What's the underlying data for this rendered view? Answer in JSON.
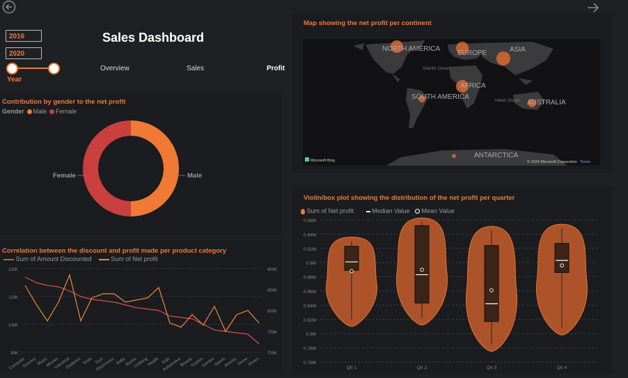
{
  "nav": {
    "back_icon": "back-arrow-icon",
    "forward_icon": "forward-arrow-icon"
  },
  "header": {
    "title": "Sales Dashboard"
  },
  "year_filter": {
    "start": "2016",
    "end": "2020",
    "label": "Year"
  },
  "tabs": [
    {
      "label": "Overview"
    },
    {
      "label": "Sales"
    },
    {
      "label": "Profit"
    }
  ],
  "donut": {
    "title": "Contribution by gender to the net profit",
    "legend_title": "Gender",
    "legend": [
      {
        "label": "Male",
        "color": "#f07a35"
      },
      {
        "label": "Female",
        "color": "#c9403f"
      }
    ],
    "labels": {
      "female": "Female",
      "male": "Male"
    }
  },
  "map": {
    "title": "Map showing the net profit per continent",
    "continents": [
      "NORTH AMERICA",
      "EUROPE",
      "ASIA",
      "AFRICA",
      "SOUTH AMERICA",
      "AUSTRALIA",
      "ANTARCTICA"
    ],
    "oceans": [
      "Atlantic Ocean",
      "Indian Ocean"
    ],
    "logo": "Microsoft Bing",
    "copyright": "© 2024 Microsoft Corporation",
    "terms": "Terms"
  },
  "line": {
    "title": "Correlation between the discount and profit made per product category",
    "legend": [
      {
        "label": "Sum of Amount Discounted",
        "color": "#d9504a"
      },
      {
        "label": "Sum of Net profit",
        "color": "#f08a3a"
      }
    ],
    "left_ticks": [
      "120K",
      "110K",
      "100K",
      "90K"
    ],
    "right_ticks": [
      "900K",
      "850K",
      "800K",
      "750K",
      "700K"
    ]
  },
  "violin": {
    "title": "Violin/box plot showing the distribution of the net profit per quarter",
    "legend": [
      {
        "label": "Sum of Net profit"
      },
      {
        "label": "Median Value"
      },
      {
        "label": "Mean Value"
      }
    ],
    "y_ticks": [
      "0.96M",
      "0.94M",
      "0.92M",
      "0.9M",
      "0.88M",
      "0.86M",
      "0.84M",
      "0.82M",
      "0.8M",
      "0.78M",
      "0.76M"
    ]
  },
  "chart_data": [
    {
      "type": "pie",
      "title": "Contribution by gender to the net profit",
      "categories": [
        "Male",
        "Female"
      ],
      "values": [
        50,
        50
      ],
      "legend_title": "Gender",
      "legend_position": "top-left",
      "colors": [
        "#f07a35",
        "#c9403f"
      ]
    },
    {
      "type": "line",
      "title": "Correlation between the discount and profit made per product category",
      "categories": [
        "Computer",
        "Grocery",
        "Music",
        "Movies",
        "Industrial",
        "Outdoors",
        "Tools",
        "Toys",
        "Electronics",
        "Baby",
        "Books",
        "Clothing",
        "Health",
        "Kids",
        "Automotive",
        "Beauty",
        "Games",
        "Garden",
        "Sports",
        "Jewelry",
        "Home",
        "Shoes"
      ],
      "series": [
        {
          "name": "Sum of Amount Discounted",
          "axis": "left",
          "values": [
            117,
            115,
            114,
            113.5,
            112,
            110,
            109,
            108.5,
            108,
            107,
            106,
            105.5,
            105,
            103,
            102.5,
            102,
            100,
            98,
            97.5,
            97,
            96.5,
            93
          ]
        },
        {
          "name": "Sum of Net profit",
          "axis": "right",
          "values": [
            860,
            815,
            775,
            820,
            885,
            775,
            830,
            840,
            840,
            820,
            825,
            830,
            855,
            770,
            760,
            790,
            765,
            810,
            750,
            790,
            800,
            770
          ]
        }
      ],
      "ylim_left": [
        90,
        120
      ],
      "ylim_right": [
        700,
        900
      ],
      "legend_position": "top-left",
      "grid": true
    },
    {
      "type": "violin",
      "title": "Violin/box plot showing the distribution of the net profit per quarter",
      "categories": [
        "Qtr 1",
        "Qtr 2",
        "Qtr 3",
        "Qtr 4"
      ],
      "series": [
        {
          "name": "Qtr 1",
          "min": 0.82,
          "q1": 0.889,
          "median": 0.901,
          "q3": 0.923,
          "max": 0.93,
          "mean": 0.888
        },
        {
          "name": "Qtr 2",
          "min": 0.822,
          "q1": 0.843,
          "median": 0.883,
          "q3": 0.952,
          "max": 0.957,
          "mean": 0.89
        },
        {
          "name": "Qtr 3",
          "min": 0.785,
          "q1": 0.817,
          "median": 0.842,
          "q3": 0.924,
          "max": 0.945,
          "mean": 0.861
        },
        {
          "name": "Qtr 4",
          "min": 0.808,
          "q1": 0.886,
          "median": 0.903,
          "q3": 0.927,
          "max": 0.948,
          "mean": 0.896
        }
      ],
      "ylim": [
        0.76,
        0.96
      ],
      "legend_position": "top-left",
      "grid": true
    }
  ]
}
